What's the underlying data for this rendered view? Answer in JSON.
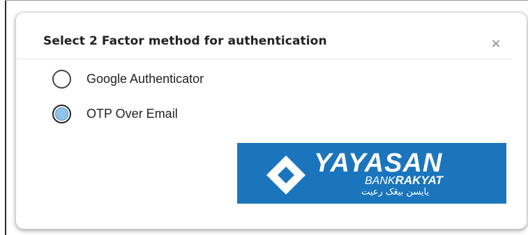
{
  "modal": {
    "title": "Select 2 Factor method for authentication",
    "close_label": "×",
    "options": [
      {
        "label": "Google Authenticator",
        "selected": false
      },
      {
        "label": "OTP Over Email",
        "selected": true
      }
    ]
  },
  "logo": {
    "main_text": "YAYASAN",
    "sub_text_light": "BANK",
    "sub_text_bold": "RAKYAT",
    "jawi_text": "يايسن بيڠک رعيت",
    "background_color": "#1b75bc",
    "mark_icon": "yayasan-emblem-icon"
  },
  "theme": {
    "radio_selected_fill": "#8fc4ea"
  }
}
